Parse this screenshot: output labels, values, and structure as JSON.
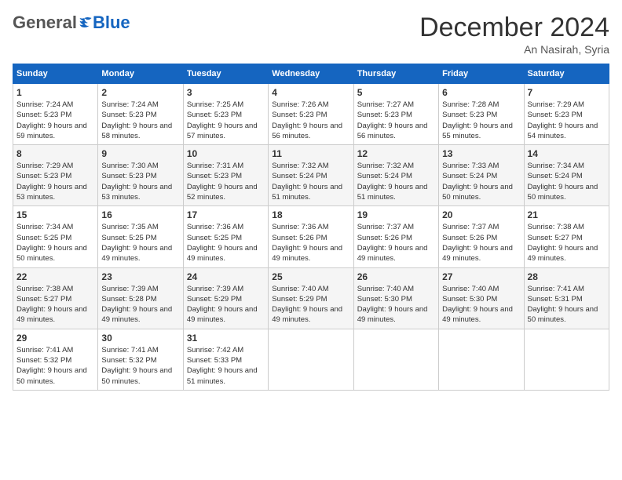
{
  "header": {
    "logo_general": "General",
    "logo_blue": "Blue",
    "month_title": "December 2024",
    "location": "An Nasirah, Syria"
  },
  "days_of_week": [
    "Sunday",
    "Monday",
    "Tuesday",
    "Wednesday",
    "Thursday",
    "Friday",
    "Saturday"
  ],
  "weeks": [
    [
      {
        "day": 1,
        "sunrise": "7:24 AM",
        "sunset": "5:23 PM",
        "daylight": "9 hours and 59 minutes."
      },
      {
        "day": 2,
        "sunrise": "7:24 AM",
        "sunset": "5:23 PM",
        "daylight": "9 hours and 58 minutes."
      },
      {
        "day": 3,
        "sunrise": "7:25 AM",
        "sunset": "5:23 PM",
        "daylight": "9 hours and 57 minutes."
      },
      {
        "day": 4,
        "sunrise": "7:26 AM",
        "sunset": "5:23 PM",
        "daylight": "9 hours and 56 minutes."
      },
      {
        "day": 5,
        "sunrise": "7:27 AM",
        "sunset": "5:23 PM",
        "daylight": "9 hours and 56 minutes."
      },
      {
        "day": 6,
        "sunrise": "7:28 AM",
        "sunset": "5:23 PM",
        "daylight": "9 hours and 55 minutes."
      },
      {
        "day": 7,
        "sunrise": "7:29 AM",
        "sunset": "5:23 PM",
        "daylight": "9 hours and 54 minutes."
      }
    ],
    [
      {
        "day": 8,
        "sunrise": "7:29 AM",
        "sunset": "5:23 PM",
        "daylight": "9 hours and 53 minutes."
      },
      {
        "day": 9,
        "sunrise": "7:30 AM",
        "sunset": "5:23 PM",
        "daylight": "9 hours and 53 minutes."
      },
      {
        "day": 10,
        "sunrise": "7:31 AM",
        "sunset": "5:23 PM",
        "daylight": "9 hours and 52 minutes."
      },
      {
        "day": 11,
        "sunrise": "7:32 AM",
        "sunset": "5:24 PM",
        "daylight": "9 hours and 51 minutes."
      },
      {
        "day": 12,
        "sunrise": "7:32 AM",
        "sunset": "5:24 PM",
        "daylight": "9 hours and 51 minutes."
      },
      {
        "day": 13,
        "sunrise": "7:33 AM",
        "sunset": "5:24 PM",
        "daylight": "9 hours and 50 minutes."
      },
      {
        "day": 14,
        "sunrise": "7:34 AM",
        "sunset": "5:24 PM",
        "daylight": "9 hours and 50 minutes."
      }
    ],
    [
      {
        "day": 15,
        "sunrise": "7:34 AM",
        "sunset": "5:25 PM",
        "daylight": "9 hours and 50 minutes."
      },
      {
        "day": 16,
        "sunrise": "7:35 AM",
        "sunset": "5:25 PM",
        "daylight": "9 hours and 49 minutes."
      },
      {
        "day": 17,
        "sunrise": "7:36 AM",
        "sunset": "5:25 PM",
        "daylight": "9 hours and 49 minutes."
      },
      {
        "day": 18,
        "sunrise": "7:36 AM",
        "sunset": "5:26 PM",
        "daylight": "9 hours and 49 minutes."
      },
      {
        "day": 19,
        "sunrise": "7:37 AM",
        "sunset": "5:26 PM",
        "daylight": "9 hours and 49 minutes."
      },
      {
        "day": 20,
        "sunrise": "7:37 AM",
        "sunset": "5:26 PM",
        "daylight": "9 hours and 49 minutes."
      },
      {
        "day": 21,
        "sunrise": "7:38 AM",
        "sunset": "5:27 PM",
        "daylight": "9 hours and 49 minutes."
      }
    ],
    [
      {
        "day": 22,
        "sunrise": "7:38 AM",
        "sunset": "5:27 PM",
        "daylight": "9 hours and 49 minutes."
      },
      {
        "day": 23,
        "sunrise": "7:39 AM",
        "sunset": "5:28 PM",
        "daylight": "9 hours and 49 minutes."
      },
      {
        "day": 24,
        "sunrise": "7:39 AM",
        "sunset": "5:29 PM",
        "daylight": "9 hours and 49 minutes."
      },
      {
        "day": 25,
        "sunrise": "7:40 AM",
        "sunset": "5:29 PM",
        "daylight": "9 hours and 49 minutes."
      },
      {
        "day": 26,
        "sunrise": "7:40 AM",
        "sunset": "5:30 PM",
        "daylight": "9 hours and 49 minutes."
      },
      {
        "day": 27,
        "sunrise": "7:40 AM",
        "sunset": "5:30 PM",
        "daylight": "9 hours and 49 minutes."
      },
      {
        "day": 28,
        "sunrise": "7:41 AM",
        "sunset": "5:31 PM",
        "daylight": "9 hours and 50 minutes."
      }
    ],
    [
      {
        "day": 29,
        "sunrise": "7:41 AM",
        "sunset": "5:32 PM",
        "daylight": "9 hours and 50 minutes."
      },
      {
        "day": 30,
        "sunrise": "7:41 AM",
        "sunset": "5:32 PM",
        "daylight": "9 hours and 50 minutes."
      },
      {
        "day": 31,
        "sunrise": "7:42 AM",
        "sunset": "5:33 PM",
        "daylight": "9 hours and 51 minutes."
      },
      null,
      null,
      null,
      null
    ]
  ],
  "labels": {
    "sunrise": "Sunrise:",
    "sunset": "Sunset:",
    "daylight": "Daylight:"
  }
}
